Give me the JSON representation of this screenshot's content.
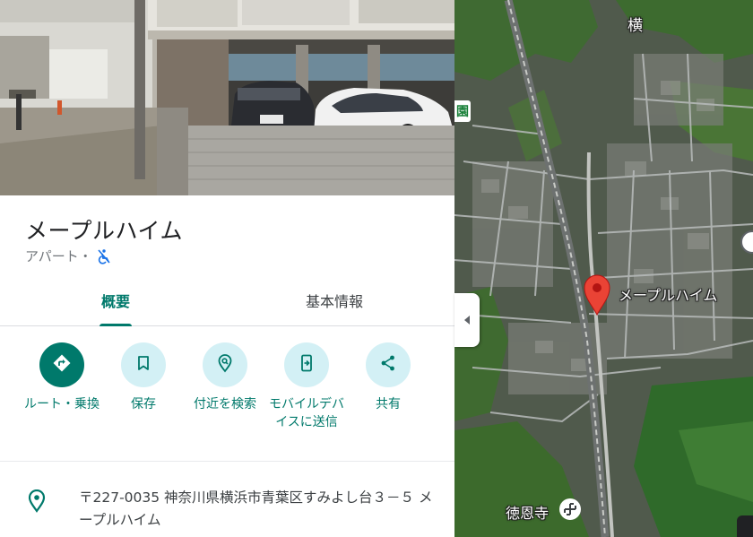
{
  "place": {
    "name": "メープルハイム",
    "category": "アパート・"
  },
  "tabs": [
    {
      "label": "概要",
      "selected": true
    },
    {
      "label": "基本情報",
      "selected": false
    }
  ],
  "actions": [
    {
      "label": "ルート・乗換",
      "icon": "directions-icon",
      "primary": true
    },
    {
      "label": "保存",
      "icon": "bookmark-icon",
      "primary": false
    },
    {
      "label": "付近を検索",
      "icon": "nearby-search-icon",
      "primary": false
    },
    {
      "label": "モバイルデバイスに送信",
      "icon": "send-to-phone-icon",
      "primary": false
    },
    {
      "label": "共有",
      "icon": "share-icon",
      "primary": false
    }
  ],
  "address": {
    "text": "〒227-0035 神奈川県横浜市青葉区すみよし台３－５ メープルハイム",
    "icon": "location-pin-icon"
  },
  "map": {
    "pin_label": "メープルハイム",
    "temple_label": "徳恩寺",
    "top_right_char": "横",
    "left_edge_char": "園"
  },
  "colors": {
    "accent": "#00796b",
    "action_bg": "#d3f0f5",
    "pin": "#ea4335"
  }
}
